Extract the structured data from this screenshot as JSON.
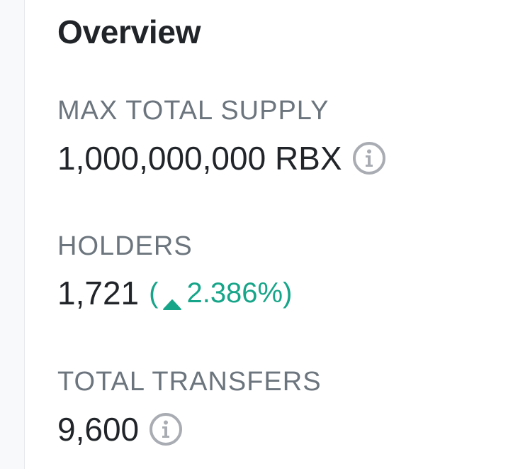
{
  "overview": {
    "title": "Overview",
    "max_supply": {
      "label": "MAX TOTAL SUPPLY",
      "value": "1,000,000,000 RBX",
      "icon": "info-icon"
    },
    "holders": {
      "label": "HOLDERS",
      "value": "1,721",
      "change_open": "(",
      "change_icon": "caret-up-icon",
      "change_value": "2.386%",
      "change_close": ")",
      "change_color": "#17a589"
    },
    "transfers": {
      "label": "TOTAL TRANSFERS",
      "value": "9,600",
      "icon": "info-icon"
    }
  },
  "colors": {
    "text_primary": "#212529",
    "text_muted": "#6c757d",
    "positive": "#17a589",
    "icon_gray": "#a9adb3"
  }
}
